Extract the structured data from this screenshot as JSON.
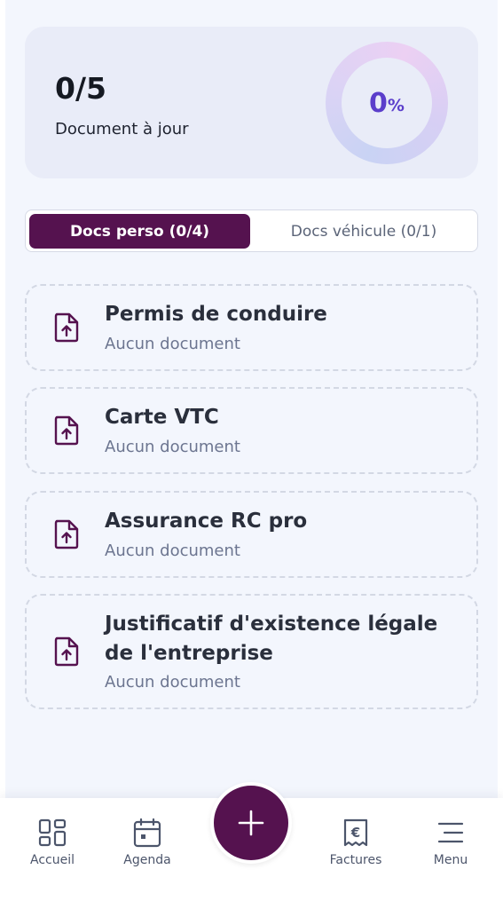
{
  "summary": {
    "count": "0/5",
    "label": "Document à jour",
    "progress_value": "0",
    "progress_unit": "%",
    "progress_fraction": 0
  },
  "tabs": [
    {
      "label": "Docs perso (0/4)",
      "active": true
    },
    {
      "label": "Docs véhicule (0/1)",
      "active": false
    }
  ],
  "documents": [
    {
      "title_lines": [
        "Permis de conduire"
      ],
      "status": "Aucun document",
      "icon": "file-upload-icon"
    },
    {
      "title_lines": [
        "Carte VTC"
      ],
      "status": "Aucun document",
      "icon": "file-upload-icon"
    },
    {
      "title_lines": [
        "Assurance RC pro"
      ],
      "status": "Aucun document",
      "icon": "file-upload-icon"
    },
    {
      "title_lines": [
        "Justificatif d'existence légale",
        "de l'entreprise"
      ],
      "status": "Aucun document",
      "icon": "file-upload-icon"
    }
  ],
  "nav": {
    "items": [
      {
        "label": "Accueil",
        "icon": "grid-icon"
      },
      {
        "label": "Agenda",
        "icon": "calendar-icon"
      },
      {
        "label": "Factures",
        "icon": "euro-receipt-icon"
      },
      {
        "label": "Menu",
        "icon": "menu-icon"
      }
    ],
    "fab_icon": "plus-icon"
  },
  "colors": {
    "brand": "#55124f",
    "accent": "#5b3ecb",
    "background": "#f3f6fd",
    "card": "#e9ecf8"
  }
}
